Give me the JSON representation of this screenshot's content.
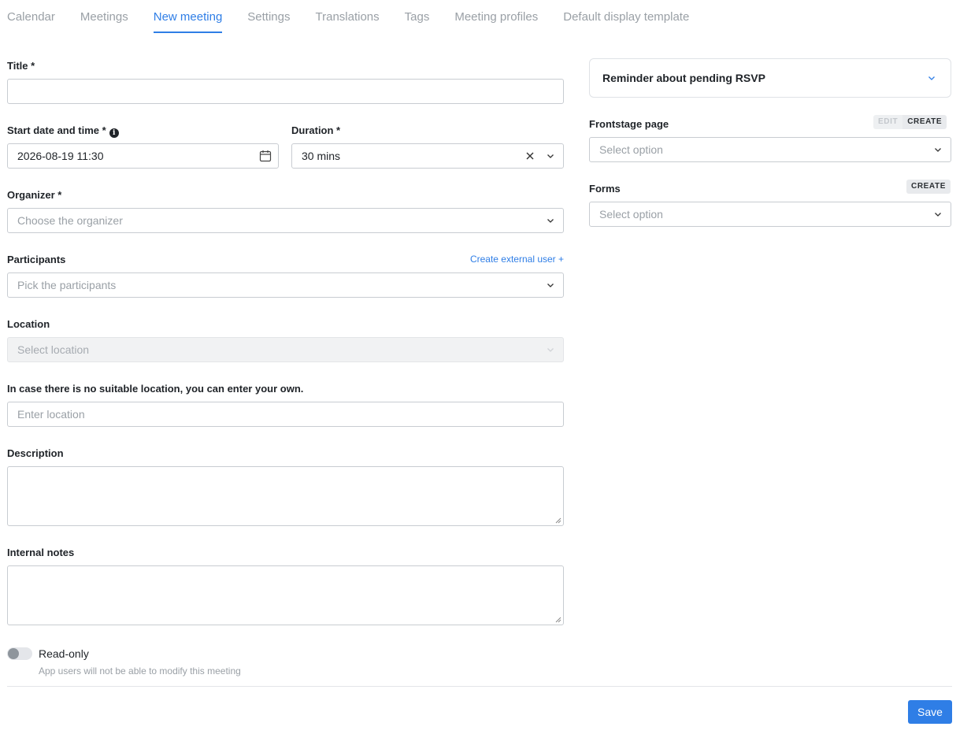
{
  "tabs": [
    {
      "label": "Calendar"
    },
    {
      "label": "Meetings"
    },
    {
      "label": "New meeting"
    },
    {
      "label": "Settings"
    },
    {
      "label": "Translations"
    },
    {
      "label": "Tags"
    },
    {
      "label": "Meeting profiles"
    },
    {
      "label": "Default display template"
    }
  ],
  "active_tab": "New meeting",
  "form": {
    "title_label": "Title *",
    "title_value": "",
    "start_label": "Start date and time *",
    "start_value": "2026-08-19 11:30",
    "duration_label": "Duration *",
    "duration_value": "30 mins",
    "organizer_label": "Organizer *",
    "organizer_placeholder": "Choose the organizer",
    "participants_label": "Participants",
    "create_external_user": "Create external user +",
    "participants_placeholder": "Pick the participants",
    "location_label": "Location",
    "location_placeholder": "Select location",
    "custom_location_label": "In case there is no suitable location, you can enter your own.",
    "custom_location_placeholder": "Enter location",
    "description_label": "Description",
    "internal_notes_label": "Internal notes",
    "readonly_label": "Read-only",
    "readonly_hint": "App users will not be able to modify this meeting",
    "readonly_on": false
  },
  "sidebar": {
    "reminder_title": "Reminder about pending RSVP",
    "frontstage_label": "Frontstage page",
    "frontstage_placeholder": "Select option",
    "forms_label": "Forms",
    "forms_placeholder": "Select option",
    "edit_label": "EDIT",
    "create_label": "CREATE"
  },
  "footer": {
    "save_label": "Save"
  },
  "colors": {
    "accent": "#2f7ee6"
  }
}
